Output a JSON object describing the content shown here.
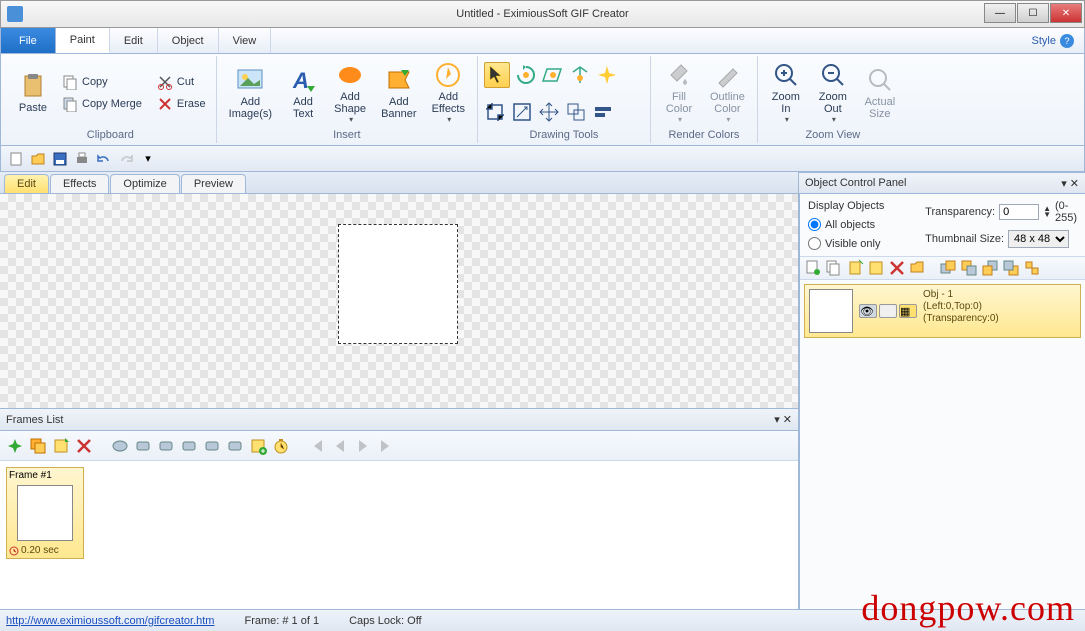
{
  "title": "Untitled - EximiousSoft GIF Creator",
  "menu": {
    "file": "File",
    "tabs": [
      "Paint",
      "Edit",
      "Object",
      "View"
    ],
    "style": "Style"
  },
  "ribbon": {
    "clipboard": {
      "paste": "Paste",
      "copy": "Copy",
      "copymerge": "Copy Merge",
      "cut": "Cut",
      "erase": "Erase",
      "label": "Clipboard"
    },
    "insert": {
      "addimages": "Add\nImage(s)",
      "addtext": "Add\nText",
      "addshape": "Add\nShape",
      "addbanner": "Add\nBanner",
      "addeffects": "Add\nEffects",
      "label": "Insert"
    },
    "drawing": {
      "label": "Drawing Tools"
    },
    "render": {
      "fill": "Fill\nColor",
      "outline": "Outline\nColor",
      "label": "Render Colors"
    },
    "zoom": {
      "in": "Zoom\nIn",
      "out": "Zoom\nOut",
      "actual": "Actual\nSize",
      "label": "Zoom View"
    }
  },
  "doctabs": [
    "Edit",
    "Effects",
    "Optimize",
    "Preview"
  ],
  "frames": {
    "title": "Frames List",
    "frame_label": "Frame #1",
    "time": "0.20 sec"
  },
  "ocp": {
    "title": "Object Control Panel",
    "display": "Display Objects",
    "all": "All objects",
    "visible": "Visible only",
    "transparency": "Transparency:",
    "trans_val": "0",
    "trans_range": "(0-255)",
    "thumbsize": "Thumbnail Size:",
    "thumb_val": "48 x 48",
    "obj": {
      "name": "Obj - 1",
      "pos": "(Left:0,Top:0)",
      "trans": "(Transparency:0)"
    }
  },
  "status": {
    "url": "http://www.eximioussoft.com/gifcreator.htm",
    "frame": "Frame: # 1 of 1",
    "caps": "Caps Lock: Off"
  },
  "watermark": "dongpow.com"
}
